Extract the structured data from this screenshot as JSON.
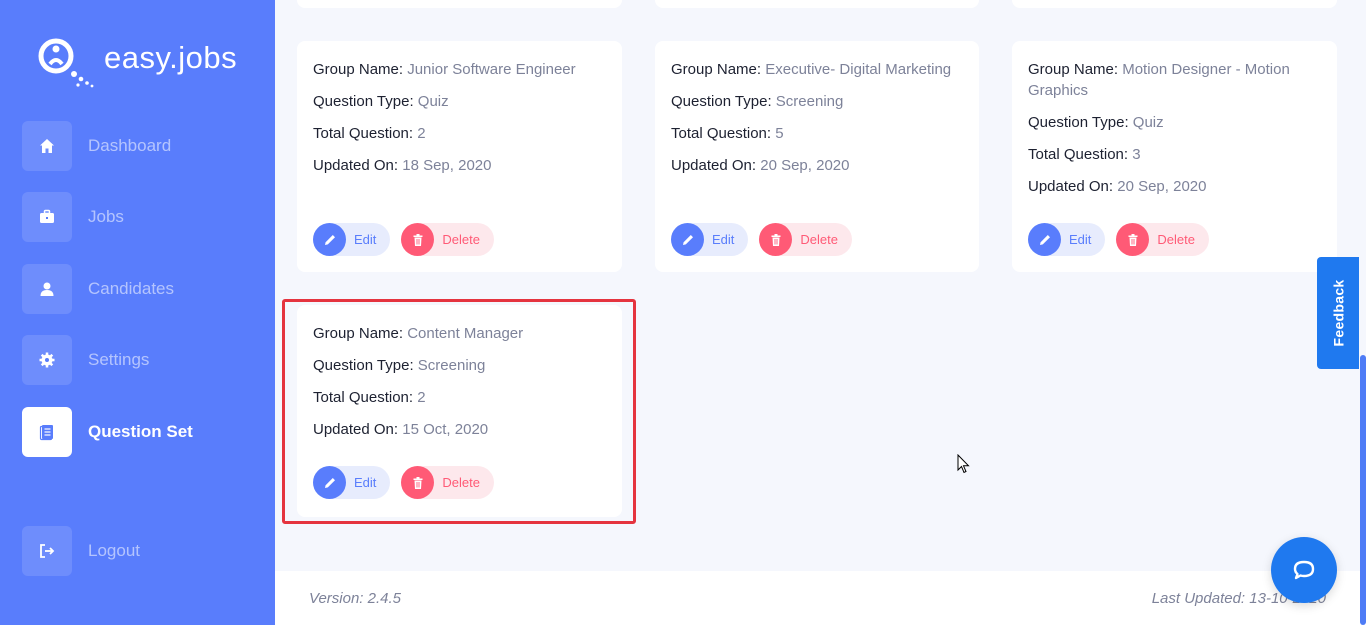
{
  "app": {
    "name": "easy.jobs"
  },
  "sidebar": {
    "items": [
      {
        "label": "Dashboard",
        "icon": "home-icon"
      },
      {
        "label": "Jobs",
        "icon": "briefcase-icon"
      },
      {
        "label": "Candidates",
        "icon": "user-icon"
      },
      {
        "label": "Settings",
        "icon": "gear-icon"
      },
      {
        "label": "Question Set",
        "icon": "document-icon",
        "active": true
      },
      {
        "label": "Logout",
        "icon": "logout-icon"
      }
    ]
  },
  "labels": {
    "group_name": "Group Name:",
    "question_type": "Question Type:",
    "total_question": "Total Question:",
    "updated_on": "Updated On:",
    "edit": "Edit",
    "delete": "Delete"
  },
  "cards": [
    {
      "group_name": "Junior Software Engineer",
      "question_type": "Quiz",
      "total_question": "2",
      "updated_on": "18 Sep, 2020"
    },
    {
      "group_name": "Executive- Digital Marketing",
      "question_type": "Screening",
      "total_question": "5",
      "updated_on": "20 Sep, 2020"
    },
    {
      "group_name": "Motion Designer - Motion Graphics",
      "question_type": "Quiz",
      "total_question": "3",
      "updated_on": "20 Sep, 2020"
    },
    {
      "group_name": "Content Manager",
      "question_type": "Screening",
      "total_question": "2",
      "updated_on": "15 Oct, 2020",
      "highlighted": true
    }
  ],
  "footer": {
    "version": "Version: 2.4.5",
    "last_updated": "Last Updated: 13-10-2020"
  },
  "feedback": {
    "label": "Feedback"
  },
  "colors": {
    "sidebar": "#597dfc",
    "primary": "#597dfc",
    "danger": "#ff5a76",
    "highlight": "#e5343f",
    "feedback": "#1f79ef"
  }
}
